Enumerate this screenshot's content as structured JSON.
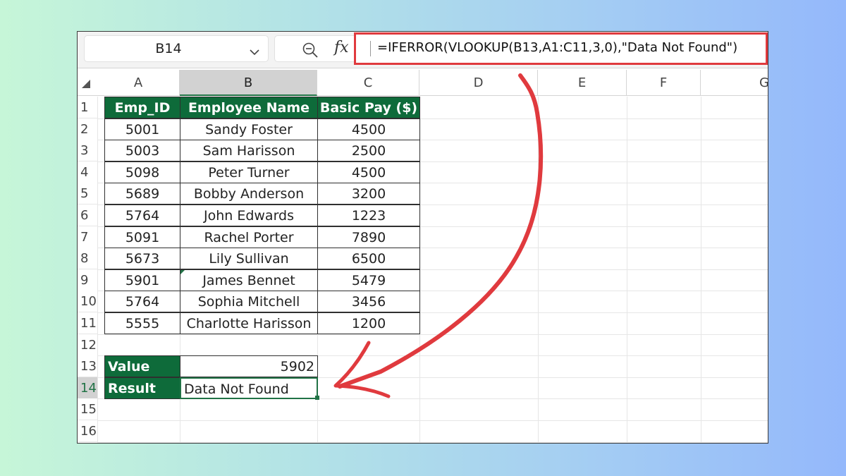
{
  "formula_bar": {
    "name_box": "B14",
    "formula": "=IFERROR(VLOOKUP(B13,A1:C11,3,0),\"Data Not Found\")"
  },
  "columns": [
    "A",
    "B",
    "C",
    "D",
    "E",
    "F",
    "G"
  ],
  "rows": [
    "1",
    "2",
    "3",
    "4",
    "5",
    "6",
    "7",
    "8",
    "9",
    "10",
    "11",
    "12",
    "13",
    "14",
    "15",
    "16"
  ],
  "table": {
    "headers": [
      "Emp_ID",
      "Employee Name",
      "Basic Pay ($)"
    ],
    "data": [
      [
        "5001",
        "Sandy Foster",
        "4500"
      ],
      [
        "5003",
        "Sam Harisson",
        "2500"
      ],
      [
        "5098",
        "Peter Turner",
        "4500"
      ],
      [
        "5689",
        "Bobby Anderson",
        "3200"
      ],
      [
        "5764",
        "John Edwards",
        "1223"
      ],
      [
        "5091",
        "Rachel Porter",
        "7890"
      ],
      [
        "5673",
        "Lily Sullivan",
        "6500"
      ],
      [
        "5901",
        "James Bennet",
        "5479"
      ],
      [
        "5764",
        "Sophia Mitchell",
        "3456"
      ],
      [
        "5555",
        "Charlotte Harisson",
        "1200"
      ]
    ]
  },
  "lookup": {
    "value_label": "Value",
    "value": "5902",
    "result_label": "Result",
    "result": "Data Not Found"
  },
  "colors": {
    "header_fill": "#0e6b3a",
    "selection_accent": "#217346",
    "annotation_red": "#e03a3e"
  }
}
